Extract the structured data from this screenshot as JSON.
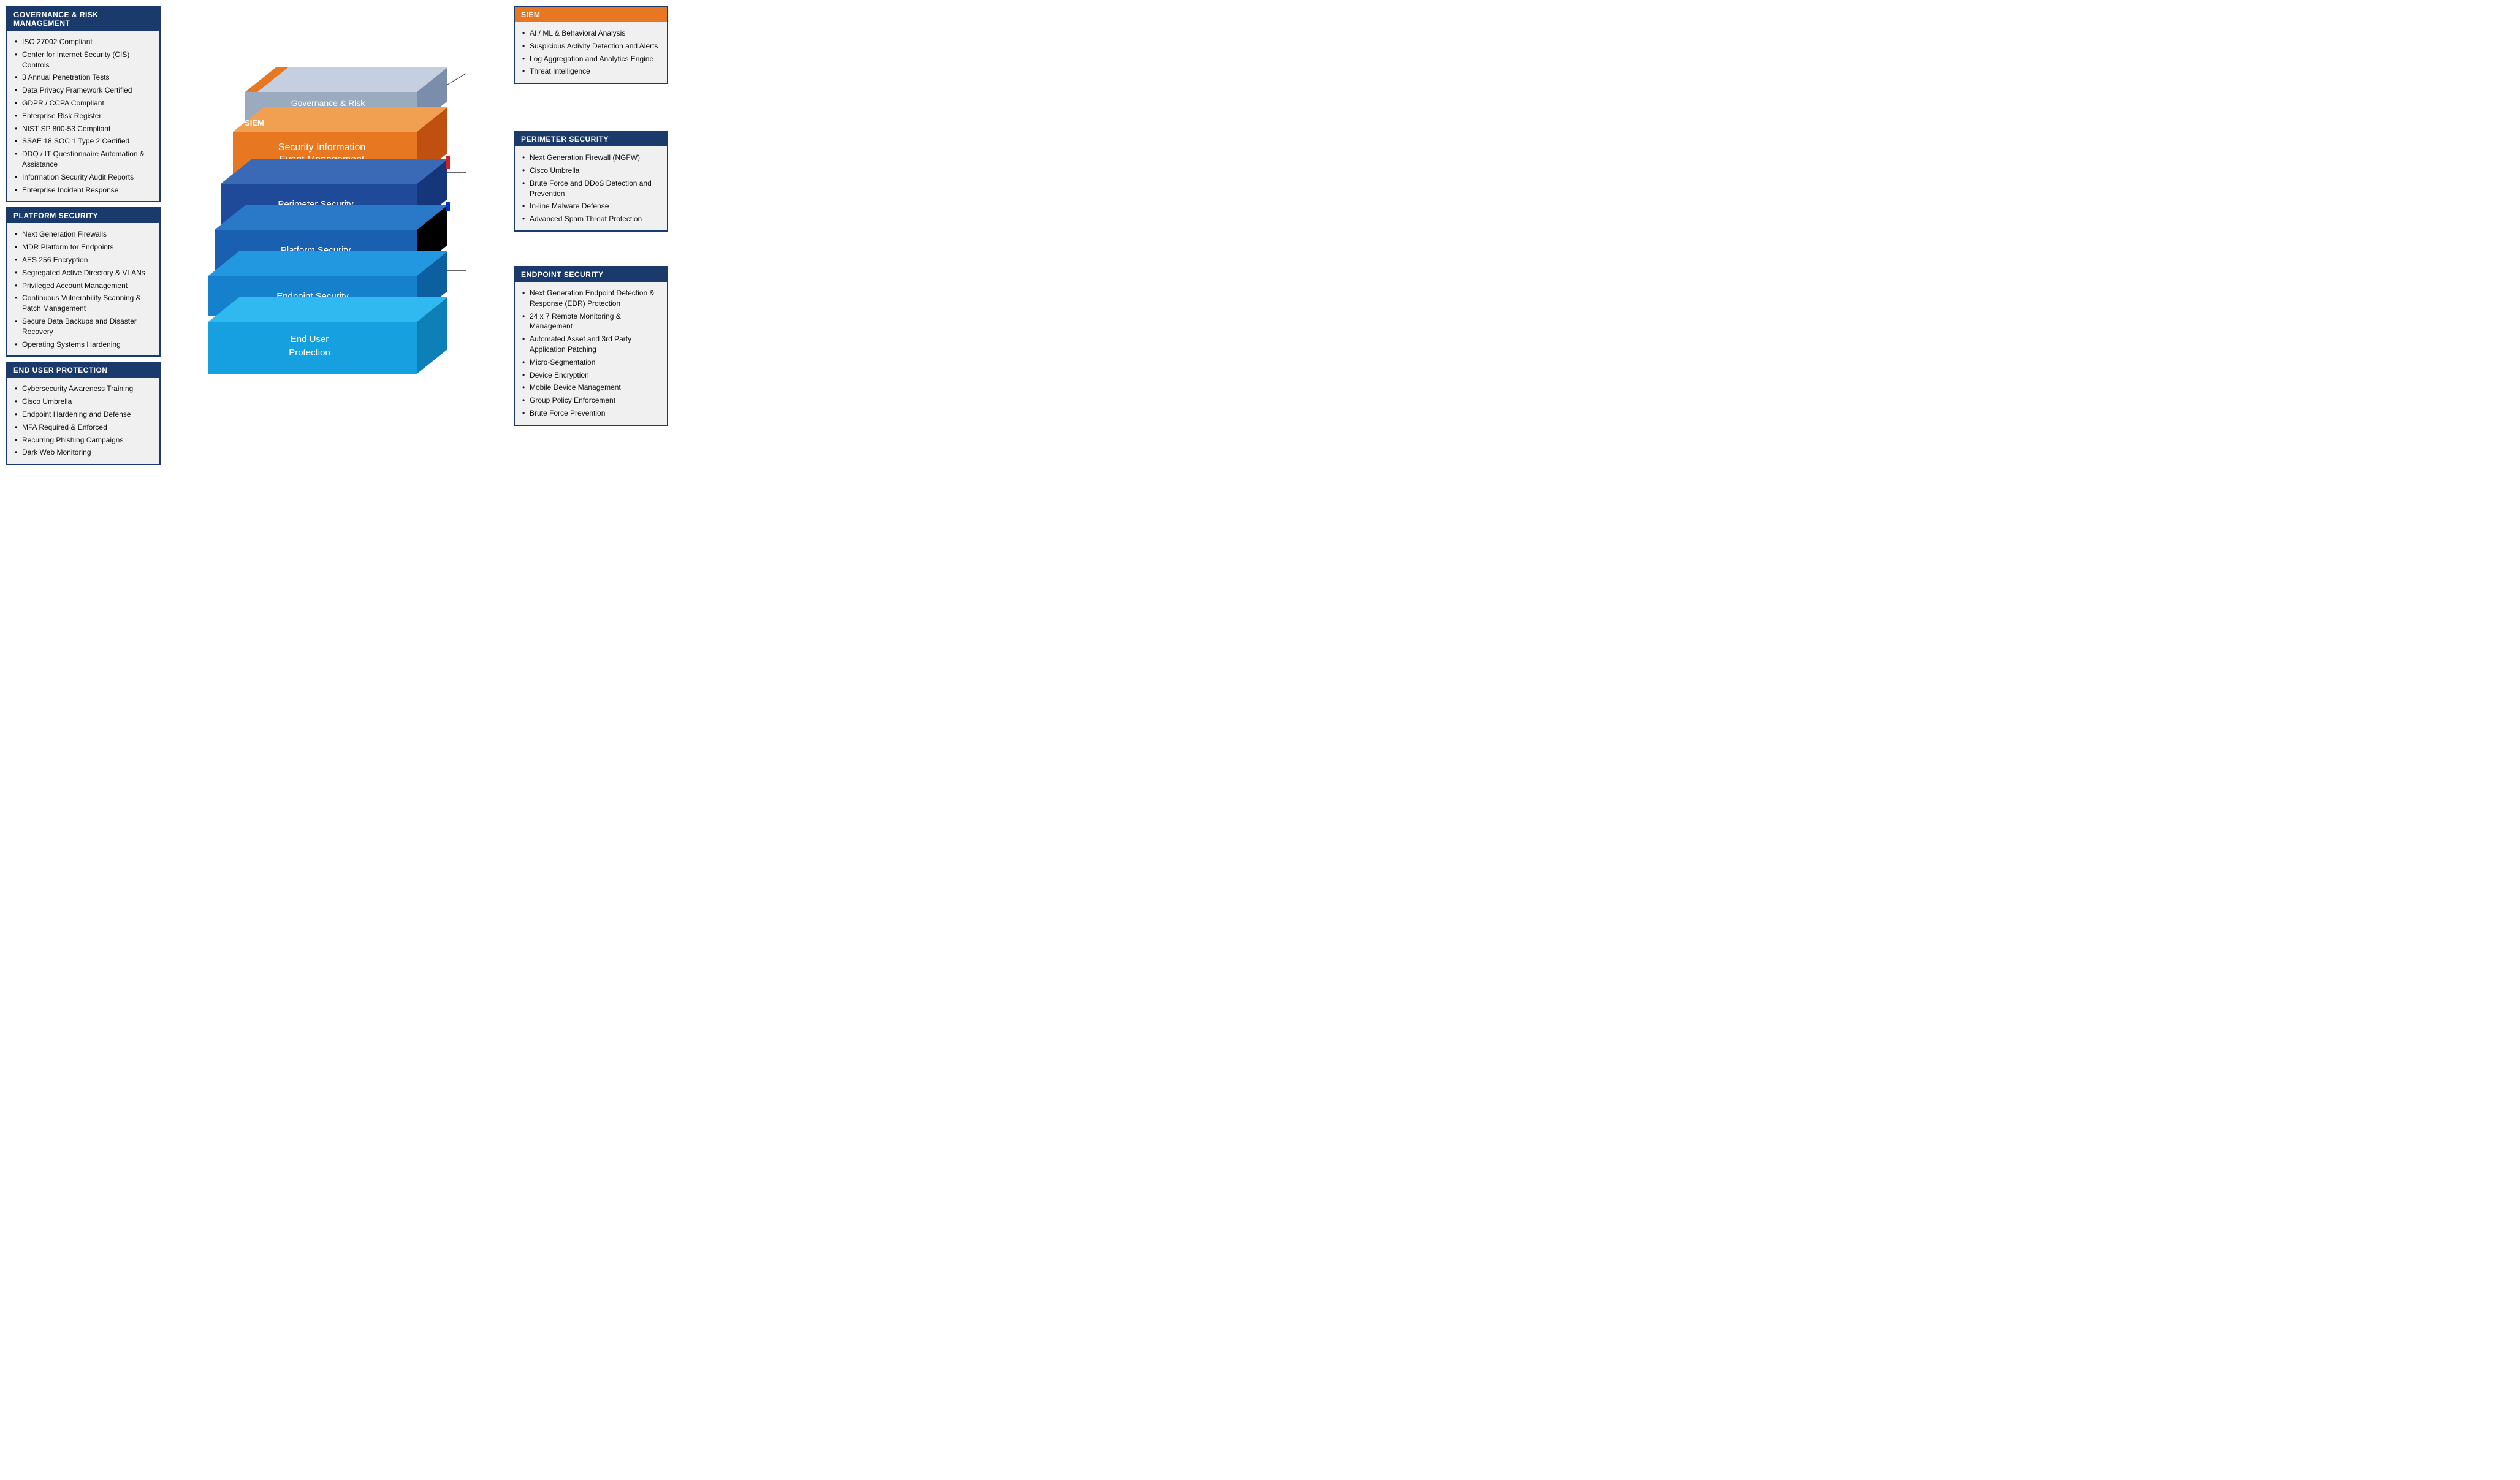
{
  "sections": {
    "governance": {
      "header": "GOVERNANCE & RISK MANAGEMENT",
      "header_class": "blue",
      "items": [
        "ISO 27002 Compliant",
        "Center for Internet Security (CIS) Controls",
        "3 Annual Penetration Tests",
        "Data Privacy Framework Certified",
        "GDPR / CCPA Compliant",
        "Enterprise Risk Register",
        "NIST SP 800-53 Compliant",
        "SSAE 18 SOC 1 Type 2 Certified",
        "DDQ / IT Questionnaire Automation & Assistance",
        "Information Security Audit Reports",
        "Enterprise Incident Response"
      ]
    },
    "platform": {
      "header": "PLATFORM SECURITY",
      "header_class": "blue",
      "items": [
        "Next Generation Firewalls",
        "MDR Platform for Endpoints",
        "AES 256 Encryption",
        "Segregated Active Directory & VLANs",
        "Privileged Account Management",
        "Continuous Vulnerability Scanning & Patch Management",
        "Secure Data Backups and Disaster Recovery",
        "Operating Systems Hardening"
      ]
    },
    "end_user": {
      "header": "END USER PROTECTION",
      "header_class": "blue",
      "items": [
        "Cybersecurity Awareness Training",
        "Cisco Umbrella",
        "Endpoint Hardening and Defense",
        "MFA Required & Enforced",
        "Recurring Phishing Campaigns",
        "Dark Web Monitoring"
      ]
    },
    "siem": {
      "header": "SIEM",
      "header_class": "orange",
      "items": [
        "AI / ML & Behavioral Analysis",
        "Suspicious Activity Detection and Alerts",
        "Log Aggregation and Analytics Engine",
        "Threat Intelligence"
      ]
    },
    "perimeter": {
      "header": "PERIMETER SECURITY",
      "header_class": "blue",
      "items": [
        "Next Generation Firewall (NGFW)",
        "Cisco Umbrella",
        "Brute Force and DDoS Detection and Prevention",
        "In-line Malware Defense",
        "Advanced Spam Threat Protection"
      ]
    },
    "endpoint": {
      "header": "ENDPOINT SECURITY",
      "header_class": "blue",
      "items": [
        "Next Generation Endpoint Detection & Response (EDR) Protection",
        "24 x 7 Remote Monitoring & Management",
        "Automated Asset and 3rd Party Application Patching",
        "Micro-Segmentation",
        "Device Encryption",
        "Mobile Device Management",
        "Group Policy Enforcement",
        "Brute Force Prevention"
      ]
    }
  },
  "stack_layers": [
    {
      "label": "Governance & Risk\nManagement",
      "color_top": "#b0bcd4",
      "color_side": "#8a9bb8",
      "color_front": "#6b7fa8"
    },
    {
      "label": "Security Information\nEvent Management",
      "color_top": "#e87722",
      "color_side": "#c95e10",
      "color_front": "#e87722"
    },
    {
      "label": "Perimeter Security",
      "color_top": "#2255a4",
      "color_side": "#1a3f7a",
      "color_front": "#1e4d99"
    },
    {
      "label": "Platform Security",
      "color_top": "#1a6fba",
      "color_side": "#145490",
      "color_front": "#1a6fba"
    },
    {
      "label": "Endpoint Security",
      "color_top": "#1589cc",
      "color_side": "#0f6099",
      "color_front": "#1589cc"
    },
    {
      "label": "End User\nProtection",
      "color_top": "#17a0e0",
      "color_side": "#1070a0",
      "color_front": "#17a0e0"
    }
  ]
}
